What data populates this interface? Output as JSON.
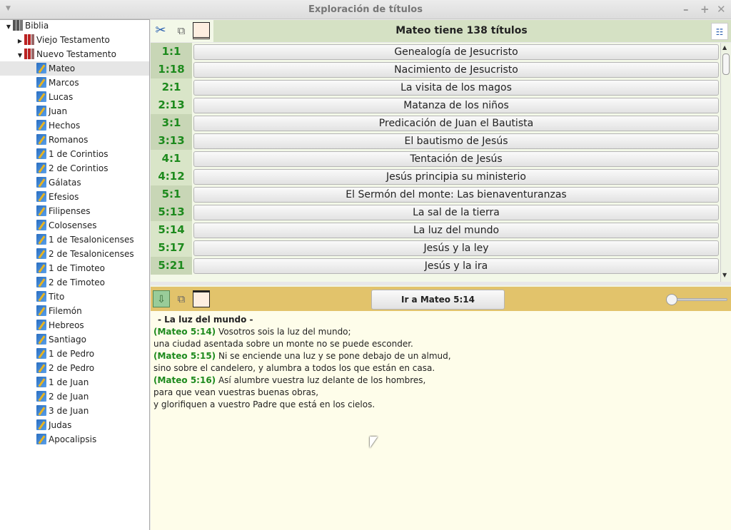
{
  "window": {
    "title": "Exploración de títulos"
  },
  "tree": {
    "root": "Biblia",
    "old": "Viejo Testamento",
    "new": "Nuevo Testamento",
    "books": [
      "Mateo",
      "Marcos",
      "Lucas",
      "Juan",
      "Hechos",
      "Romanos",
      "1 de Corintios",
      "2 de Corintios",
      "Gálatas",
      "Efesios",
      "Filipenses",
      "Colosenses",
      "1 de Tesalonicenses",
      "2 de Tesalonicenses",
      "1 de Timoteo",
      "2 de Timoteo",
      "Tito",
      "Filemón",
      "Hebreos",
      "Santiago",
      "1 de Pedro",
      "2 de Pedro",
      "1 de Juan",
      "2 de Juan",
      "3 de Juan",
      "Judas",
      "Apocalipsis"
    ],
    "selected": "Mateo"
  },
  "header": {
    "title": "Mateo tiene 138 títulos"
  },
  "titles": [
    {
      "ref": "1:1",
      "title": "Genealogía de Jesucristo"
    },
    {
      "ref": "1:18",
      "title": "Nacimiento de Jesucristo"
    },
    {
      "ref": "2:1",
      "title": "La visita de los magos"
    },
    {
      "ref": "2:13",
      "title": "Matanza de los niños"
    },
    {
      "ref": "3:1",
      "title": "Predicación de Juan el Bautista"
    },
    {
      "ref": "3:13",
      "title": "El bautismo de Jesús"
    },
    {
      "ref": "4:1",
      "title": "Tentación de Jesús"
    },
    {
      "ref": "4:12",
      "title": "Jesús principia su ministerio"
    },
    {
      "ref": "5:1",
      "title": "El Sermón del monte: Las bienaventuranzas"
    },
    {
      "ref": "5:13",
      "title": "La sal de la tierra"
    },
    {
      "ref": "5:14",
      "title": "La luz del mundo"
    },
    {
      "ref": "5:17",
      "title": "Jesús y la ley"
    },
    {
      "ref": "5:21",
      "title": "Jesús y la ira"
    }
  ],
  "bottom": {
    "goto_label": "Ir a Mateo 5:14",
    "slider_value": 0
  },
  "passage": {
    "heading": "- La luz del mundo -",
    "lines": [
      {
        "ref": "(Mateo 5:14)",
        "text": " Vosotros sois la luz del mundo;"
      },
      {
        "ref": "",
        "text": "una ciudad asentada sobre un monte no se puede esconder."
      },
      {
        "ref": "(Mateo 5:15)",
        "text": " Ni se enciende una luz y se pone debajo de un almud,"
      },
      {
        "ref": "",
        "text": "sino sobre el candelero, y alumbra a todos los que están en casa."
      },
      {
        "ref": "(Mateo 5:16)",
        "text": " Así alumbre vuestra luz delante de los hombres,"
      },
      {
        "ref": "",
        "text": "para que vean vuestras buenas obras,"
      },
      {
        "ref": "",
        "text": "y glorifiquen a vuestro Padre que está en los cielos."
      }
    ]
  }
}
